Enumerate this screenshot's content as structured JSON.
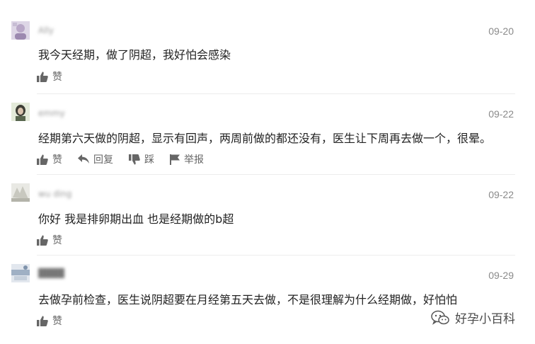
{
  "comments": [
    {
      "user": "Ally",
      "date": "09-20",
      "text": "我今天经期，做了阴超，我好怕会感染",
      "like_label": "赞"
    },
    {
      "user": "emmy",
      "date": "09-22",
      "text": "经期第六天做的阴超，显示有回声，两周前做的都还没有，医生让下周再去做一个，很晕。",
      "like_label": "赞",
      "reply_label": "回复",
      "dislike_label": "踩",
      "report_label": "举报"
    },
    {
      "user": "wu ding",
      "date": "09-22",
      "text": "你好 我是排卵期出血 也是经期做的b超",
      "like_label": "赞"
    },
    {
      "user": "████",
      "date": "09-29",
      "text": "去做孕前检查，医生说阴超要在月经第五天去做，不是很理解为什么经期做，好怕怕",
      "like_label": "赞"
    }
  ],
  "watermark": {
    "text": "好孕小百科",
    "icon": "wechat-icon"
  }
}
